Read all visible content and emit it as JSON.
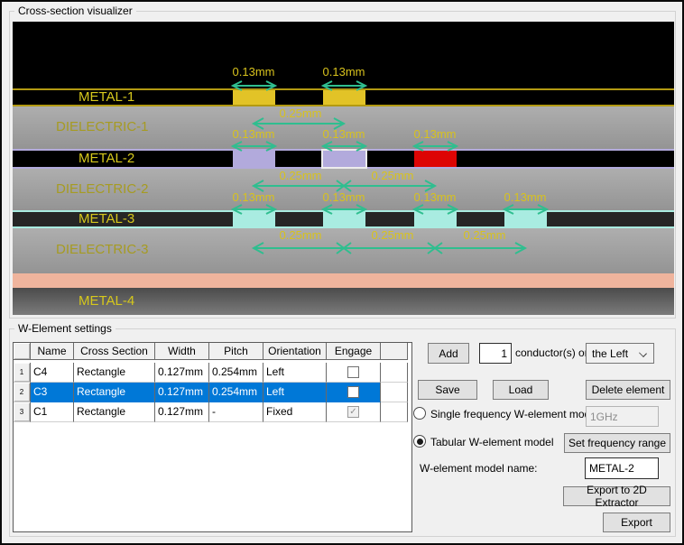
{
  "visualizer": {
    "title": "Cross-section visualizer",
    "width_label": "0.13mm",
    "pitch_label": "0.25mm",
    "arrow_color": "#2fbe8f",
    "dim_text_color": "#d8c21d",
    "layers": {
      "metal1": {
        "label": "METAL-1",
        "line_color": "#b39a12",
        "conductor_color": "#e2c327",
        "conductor_count": 2
      },
      "dielectric1": {
        "label": "DIELECTRIC-1"
      },
      "metal2": {
        "label": "METAL-2",
        "line_color": "#b2aadc",
        "conductor_color": "#b2aadc",
        "selected_outline_color": "#ececec",
        "engaged_conductor_color": "#dd0404",
        "conductor_count": 3
      },
      "dielectric2": {
        "label": "DIELECTRIC-2"
      },
      "metal3": {
        "label": "METAL-3",
        "line_color": "#a9ece1",
        "conductor_color": "#a9ece1",
        "conductor_count": 4
      },
      "dielectric3": {
        "label": "DIELECTRIC-3"
      },
      "substrate_color": "#efb49d",
      "metal4": {
        "label": "METAL-4"
      }
    }
  },
  "settings": {
    "title": "W-Element settings",
    "selection_color": "#0078d7",
    "check_glyph": "✓",
    "table": {
      "columns": [
        "",
        "Name",
        "Cross Section",
        "Width",
        "Pitch",
        "Orientation",
        "Engage",
        ""
      ],
      "rows": [
        {
          "num": "1",
          "name": "C4",
          "cross_section": "Rectangle",
          "width": "0.127mm",
          "pitch": "0.254mm",
          "orientation": "Left",
          "engaged": false,
          "selected": false
        },
        {
          "num": "2",
          "name": "C3",
          "cross_section": "Rectangle",
          "width": "0.127mm",
          "pitch": "0.254mm",
          "orientation": "Left",
          "engaged": false,
          "selected": true
        },
        {
          "num": "3",
          "name": "C1",
          "cross_section": "Rectangle",
          "width": "0.127mm",
          "pitch": "-",
          "orientation": "Fixed",
          "engaged": true,
          "selected": false
        }
      ]
    },
    "add": {
      "button": "Add",
      "count": "1",
      "label": "conductor(s) on",
      "side": "the Left"
    },
    "save_button": "Save",
    "load_button": "Load",
    "delete_button": "Delete element",
    "single_freq": {
      "label": "Single frequency W-element model",
      "selected": false,
      "value": "1GHz"
    },
    "tabular": {
      "label": "Tabular W-element model",
      "selected": true,
      "set_range_button": "Set frequency range"
    },
    "model_name": {
      "label": "W-element model name:",
      "value": "METAL-2"
    },
    "export_2d_button": "Export to 2D Extractor",
    "export_button": "Export"
  }
}
